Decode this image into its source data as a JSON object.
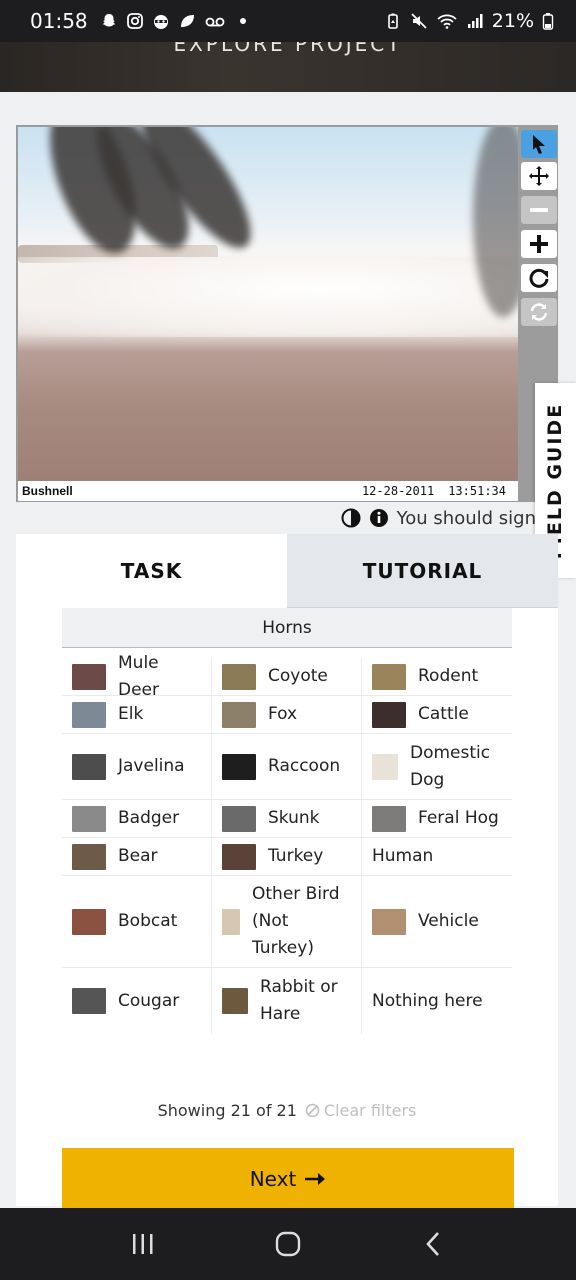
{
  "status_bar": {
    "time": "01:58",
    "battery": "21%",
    "left_icons": [
      "snapchat-icon",
      "instagram-icon",
      "raccoon-app-icon",
      "leaf-icon",
      "voicemail-icon",
      "dot-icon"
    ],
    "right_icons": [
      "battery-saver-icon",
      "mute-icon",
      "wifi-icon",
      "signal-icon",
      "battery-icon"
    ]
  },
  "header": {
    "title": "EXPLORE PROJECT"
  },
  "image": {
    "brand": "Bushnell",
    "date": "12-28-2011",
    "time": "13:51:34"
  },
  "toolbar": {
    "tools": [
      "pointer-icon",
      "move-icon",
      "zoom-out-icon",
      "zoom-in-icon",
      "rotate-icon",
      "reset-icon"
    ]
  },
  "meta": {
    "text": "You should sign"
  },
  "field_guide": {
    "label": "FIELD GUIDE"
  },
  "tabs": {
    "task": "TASK",
    "tutorial": "TUTORIAL"
  },
  "filter": {
    "label": "Horns"
  },
  "choices": [
    [
      {
        "label": "Mule Deer",
        "thumb": "#6b4a47"
      },
      {
        "label": "Coyote",
        "thumb": "#8a7a55"
      },
      {
        "label": "Rodent",
        "thumb": "#9a845c"
      }
    ],
    [
      {
        "label": "Elk",
        "thumb": "#7d8a96"
      },
      {
        "label": "Fox",
        "thumb": "#8c8168"
      },
      {
        "label": "Cattle",
        "thumb": "#3d2e2e"
      }
    ],
    [
      {
        "label": "Javelina",
        "thumb": "#4d4d4d"
      },
      {
        "label": "Raccoon",
        "thumb": "#1e1e1e"
      },
      {
        "label": "Domestic Dog",
        "thumb": "#e9e2d8"
      }
    ],
    [
      {
        "label": "Badger",
        "thumb": "#8a8a8a"
      },
      {
        "label": "Skunk",
        "thumb": "#6a6a6a"
      },
      {
        "label": "Feral Hog",
        "thumb": "#7d7a7a"
      }
    ],
    [
      {
        "label": "Bear",
        "thumb": "#6e5a48"
      },
      {
        "label": "Turkey",
        "thumb": "#5a4238"
      },
      {
        "label": "Human",
        "thumb": ""
      }
    ],
    [
      {
        "label": "Bobcat",
        "thumb": "#8a5040"
      },
      {
        "label": "Other Bird (Not Turkey)",
        "thumb": "#d6c8b0"
      },
      {
        "label": "Vehicle",
        "thumb": "#b09070"
      }
    ],
    [
      {
        "label": "Cougar",
        "thumb": "#555555"
      },
      {
        "label": "Rabbit or Hare",
        "thumb": "#6d5a3e"
      },
      {
        "label": "Nothing here",
        "thumb": ""
      }
    ]
  ],
  "showing": {
    "text": "Showing 21 of 21",
    "clear": "Clear filters"
  },
  "next": {
    "label": "Next"
  },
  "nav": {
    "buttons": [
      "recents-icon",
      "home-icon",
      "back-icon"
    ]
  },
  "colors": {
    "accent": "#f0b200",
    "active_tool": "#4aa0e0"
  }
}
